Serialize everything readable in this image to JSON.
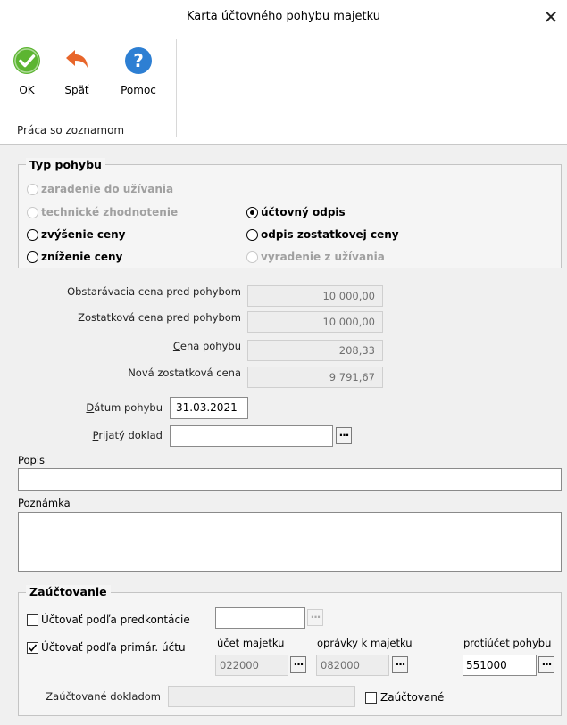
{
  "window": {
    "title": "Karta účtovného pohybu majetku",
    "close_glyph": "✕"
  },
  "ribbon": {
    "ok_label": "OK",
    "back_label": "Späť",
    "help_label": "Pomoc",
    "group_label": "Práca so zoznamom",
    "colors": {
      "ok": "#5cb531",
      "back": "#e8662b",
      "help": "#2d7fd3"
    }
  },
  "type_group": {
    "title": "Typ pohybu",
    "options": [
      {
        "label": "zaradenie do užívania",
        "enabled": false,
        "selected": false
      },
      {
        "label": "technické zhodnotenie",
        "enabled": false,
        "selected": false
      },
      {
        "label": "účtovný odpis",
        "enabled": true,
        "selected": true
      },
      {
        "label": "zvýšenie ceny",
        "enabled": true,
        "selected": false
      },
      {
        "label": "odpis zostatkovej ceny",
        "enabled": true,
        "selected": false
      },
      {
        "label": "zníženie ceny",
        "enabled": true,
        "selected": false
      },
      {
        "label": "vyradenie z užívania",
        "enabled": false,
        "selected": false
      }
    ]
  },
  "values": {
    "acq_label": "Obstarávacia cena pred pohybom",
    "acq_value": "10 000,00",
    "residual_label": "Zostatková cena pred pohybom",
    "residual_value": "10 000,00",
    "move_label_first": "C",
    "move_label_rest": "ena pohybu",
    "move_value": "208,33",
    "new_label": "Nová zostatková cena",
    "new_value": "9 791,67"
  },
  "date": {
    "label_first": "D",
    "label_rest": "átum pohybu",
    "value": "31.03.2021"
  },
  "doc": {
    "label_first": "P",
    "label_rest": "rijatý doklad",
    "value": ""
  },
  "popis": {
    "label": "Popis",
    "value": ""
  },
  "poznamka": {
    "label": "Poznámka",
    "value": ""
  },
  "posting": {
    "title": "Zaúčtovanie",
    "predkontacia_label": "Účtovať podľa predkontácie",
    "predkontacia_checked": false,
    "primar_label": "Účtovať podľa primár. účtu",
    "primar_checked": true,
    "ucet_label": "účet majetku",
    "ucet_value": "022000",
    "opravky_label": "oprávky k majetku",
    "opravky_value": "082000",
    "protiucet_label": "protiúčet pohybu",
    "protiucet_value": "551000",
    "doklad_label": "Zaúčtované dokladom",
    "doklad_value": "",
    "posted_label": "Zaúčtované",
    "posted_checked": false
  },
  "icons": [
    "check-icon",
    "back-arrow-icon",
    "question-icon",
    "ellipsis-icon",
    "checkmark-icon"
  ]
}
